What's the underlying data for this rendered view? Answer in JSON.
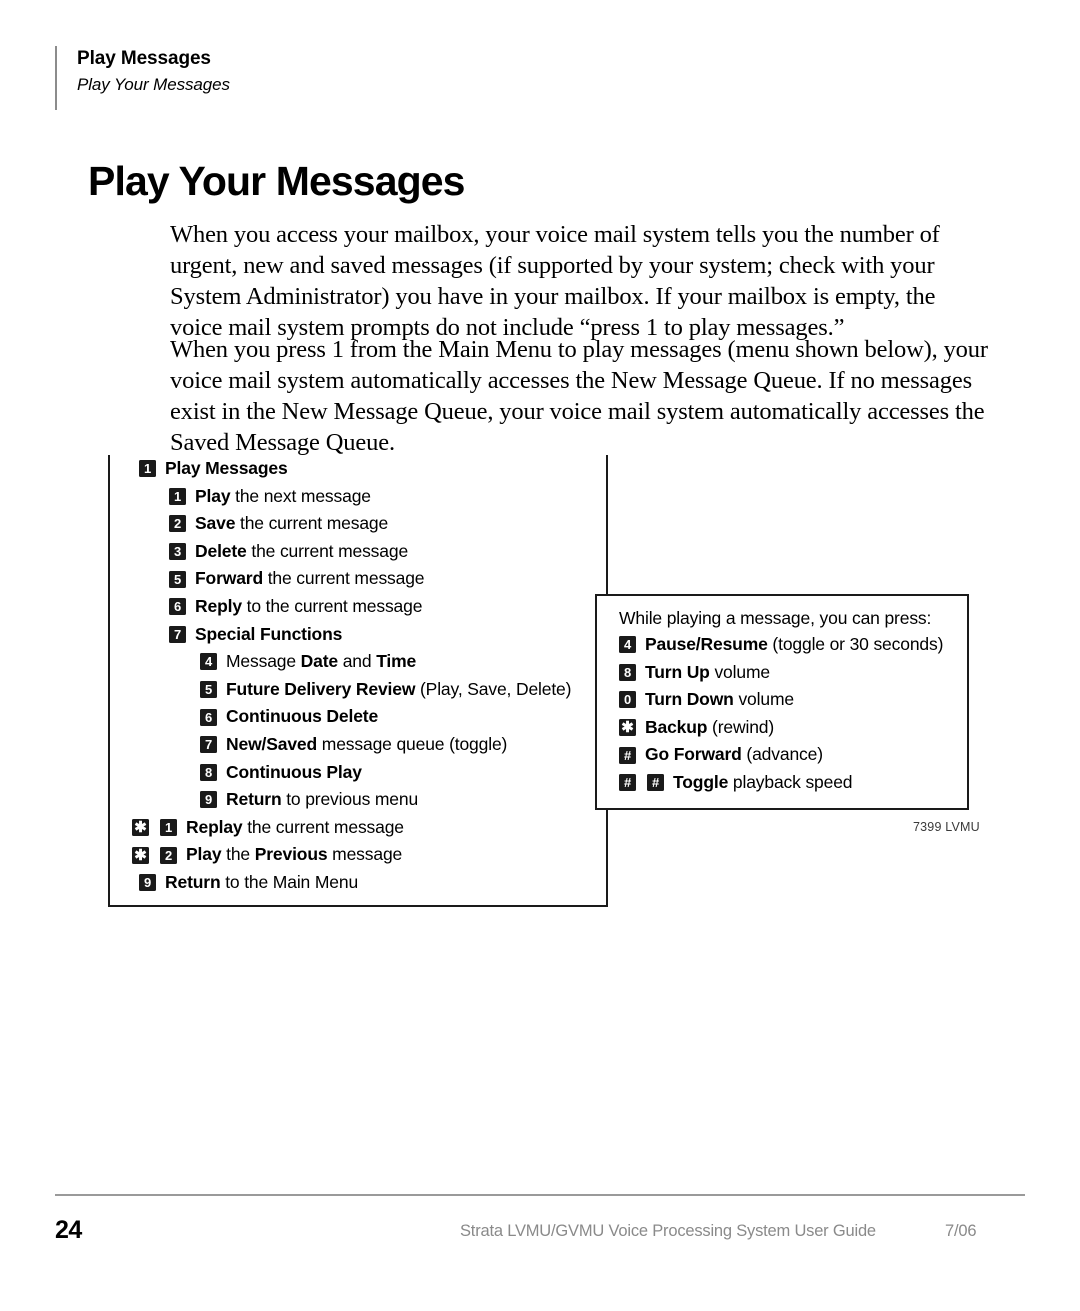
{
  "header": {
    "chapter": "Play Messages",
    "section": "Play Your Messages"
  },
  "page_title": "Play Your Messages",
  "paragraphs": [
    "When you access your mailbox, your voice mail system tells you the number of urgent, new and saved messages (if supported by your system; check with your System Administrator) you have in your mailbox. If your mailbox is empty, the voice mail system prompts do not include “press 1 to play messages.”",
    "When you press 1 from the Main Menu to play messages (menu shown below), your voice mail system automatically accesses the New Message Queue. If no messages exist in the New Message Queue, your voice mail system automatically accesses the Saved Message Queue."
  ],
  "menu_diagram": {
    "caption": "7399 LVMU",
    "main_menu": {
      "rows": [
        {
          "keys": [
            "1"
          ],
          "level": 0,
          "bold": "Play Messages",
          "rest": ""
        },
        {
          "keys": [
            "1"
          ],
          "level": 1,
          "bold": "Play",
          "rest": " the next message"
        },
        {
          "keys": [
            "2"
          ],
          "level": 1,
          "bold": "Save",
          "rest": " the current mesage"
        },
        {
          "keys": [
            "3"
          ],
          "level": 1,
          "bold": "Delete",
          "rest": " the current message"
        },
        {
          "keys": [
            "5"
          ],
          "level": 1,
          "bold": "Forward",
          "rest": " the current message"
        },
        {
          "keys": [
            "6"
          ],
          "level": 1,
          "bold": "Reply",
          "rest": " to the current message"
        },
        {
          "keys": [
            "7"
          ],
          "level": 1,
          "bold": "Special Functions",
          "rest": ""
        },
        {
          "keys": [
            "4"
          ],
          "level": 2,
          "bold": "",
          "rest": "Message ",
          "bold2": "Date",
          "rest2": " and ",
          "bold3": "Time"
        },
        {
          "keys": [
            "5"
          ],
          "level": 2,
          "bold": "Future Delivery Review",
          "rest": " (Play, Save, Delete)"
        },
        {
          "keys": [
            "6"
          ],
          "level": 2,
          "bold": "Continuous Delete",
          "rest": ""
        },
        {
          "keys": [
            "7"
          ],
          "level": 2,
          "bold": "New/Saved",
          "rest": " message queue (toggle)"
        },
        {
          "keys": [
            "8"
          ],
          "level": 2,
          "bold": "Continuous Play",
          "rest": ""
        },
        {
          "keys": [
            "9"
          ],
          "level": 2,
          "bold": "Return",
          "rest": " to previous menu"
        },
        {
          "keys": [
            "✱",
            "1"
          ],
          "level": 0,
          "bold": "Replay",
          "rest": " the current message"
        },
        {
          "keys": [
            "✱",
            "2"
          ],
          "level": 0,
          "bold": "Play",
          "rest": " the ",
          "bold2": "Previous",
          "rest2": " message"
        },
        {
          "keys": [
            "9"
          ],
          "level": 0,
          "bold": "Return",
          "rest": " to the Main Menu"
        }
      ]
    },
    "playback_box": {
      "intro": "While playing a message, you can press:",
      "rows": [
        {
          "keys": [
            "4"
          ],
          "bold": "Pause/Resume",
          "rest": " (toggle or 30 seconds)"
        },
        {
          "keys": [
            "8"
          ],
          "bold": "Turn Up",
          "rest": " volume"
        },
        {
          "keys": [
            "0"
          ],
          "bold": "Turn Down",
          "rest": " volume"
        },
        {
          "keys": [
            "✱"
          ],
          "bold": "Backup",
          "rest": " (rewind)"
        },
        {
          "keys": [
            "#"
          ],
          "bold": "Go Forward",
          "rest": " (advance)"
        },
        {
          "keys": [
            "#",
            "#"
          ],
          "bold": "Toggle",
          "rest": " playback speed"
        }
      ]
    }
  },
  "footer": {
    "page_number": "24",
    "guide_title": "Strata LVMU/GVMU Voice Processing System User Guide",
    "date": "7/06"
  }
}
